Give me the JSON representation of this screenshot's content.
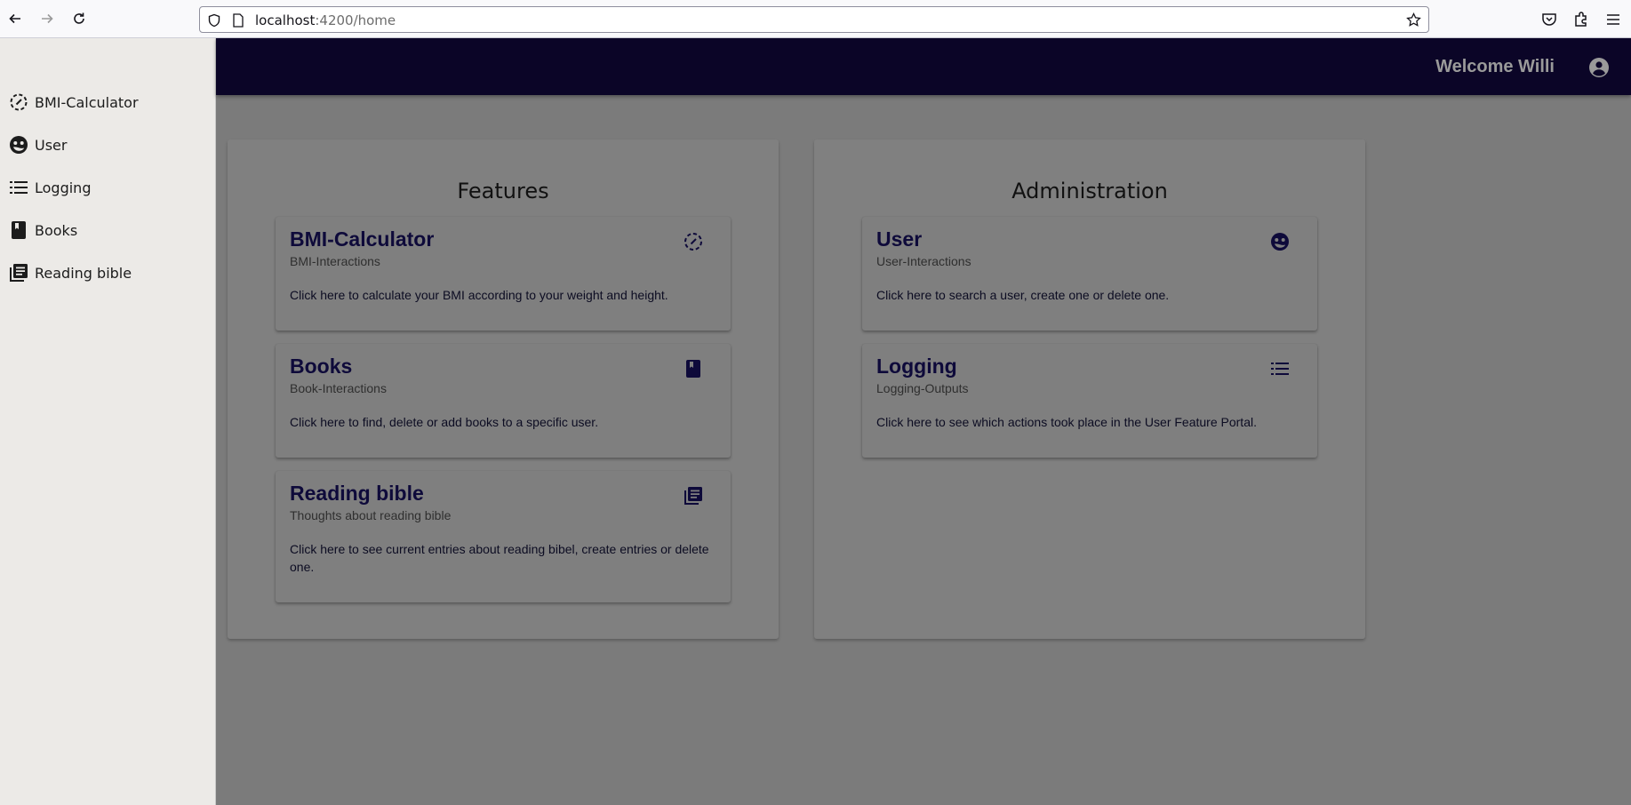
{
  "browser": {
    "url_host": "localhost",
    "url_rest": ":4200/home"
  },
  "sidebar": {
    "items": [
      {
        "label": "BMI-Calculator",
        "icon": "timer-dashed-icon"
      },
      {
        "label": "User",
        "icon": "face-icon"
      },
      {
        "label": "Logging",
        "icon": "list-icon"
      },
      {
        "label": "Books",
        "icon": "book-icon"
      },
      {
        "label": "Reading bible",
        "icon": "library-books-icon"
      }
    ]
  },
  "header": {
    "welcome": "Welcome Willi",
    "bg_color": "#0b0527"
  },
  "features": {
    "title": "Features",
    "cards": [
      {
        "title": "BMI-Calculator",
        "subtitle": "BMI-Interactions",
        "text": "Click here to calculate your BMI according to your weight and height.",
        "icon": "timer-dashed-icon"
      },
      {
        "title": "Books",
        "subtitle": "Book-Interactions",
        "text": "Click here to find, delete or add books to a specific user.",
        "icon": "book-icon"
      },
      {
        "title": "Reading bible",
        "subtitle": "Thoughts about reading bible",
        "text": "Click here to see current entries about reading bibel, create entries or delete one.",
        "icon": "library-books-icon"
      }
    ]
  },
  "administration": {
    "title": "Administration",
    "cards": [
      {
        "title": "User",
        "subtitle": "User-Interactions",
        "text": "Click here to search a user, create one or delete one.",
        "icon": "face-icon"
      },
      {
        "title": "Logging",
        "subtitle": "Logging-Outputs",
        "text": "Click here to see which actions took place in the User Feature Portal.",
        "icon": "list-icon"
      }
    ]
  }
}
